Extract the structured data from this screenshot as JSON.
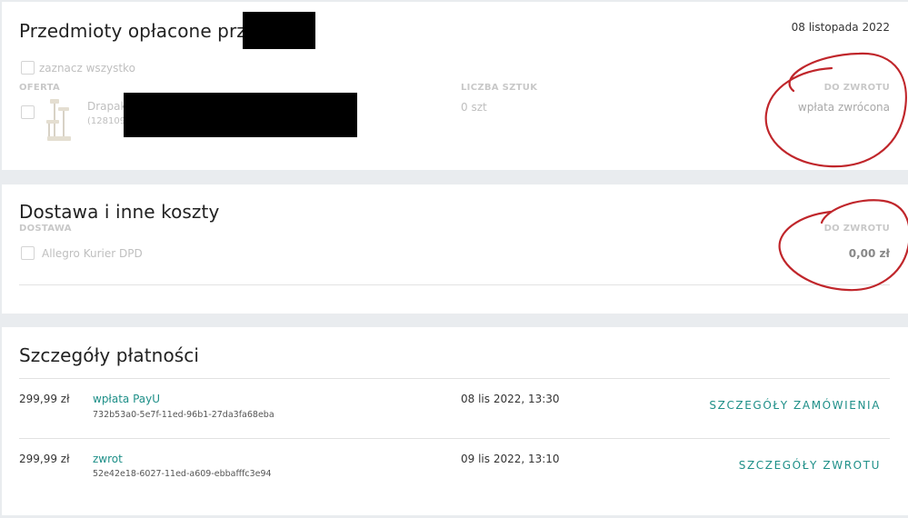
{
  "items_section": {
    "title": "Przedmioty opłacone przez",
    "date": "08 listopada 2022",
    "select_all_label": "zaznacz wszystko",
    "col_offer": "OFERTA",
    "col_quantity": "LICZBA SZTUK",
    "col_refund": "DO ZWROTU",
    "item": {
      "name": "Drapak",
      "id": "(128109",
      "quantity": "0 szt",
      "refund_status": "wpłata zwrócona"
    }
  },
  "delivery_section": {
    "title": "Dostawa i inne koszty",
    "col_delivery": "DOSTAWA",
    "col_refund": "DO ZWROTU",
    "method": "Allegro Kurier DPD",
    "refund_amount": "0,00 zł"
  },
  "payment_section": {
    "title": "Szczegóły płatności",
    "rows": [
      {
        "amount": "299,99 zł",
        "type": "wpłata PayU",
        "transaction_id": "732b53a0-5e7f-11ed-96b1-27da3fa68eba",
        "datetime": "08 lis 2022, 13:30",
        "action": "SZCZEGÓŁY ZAMÓWIENIA"
      },
      {
        "amount": "299,99 zł",
        "type": "zwrot",
        "transaction_id": "52e42e18-6027-11ed-a609-ebbafffc3e94",
        "datetime": "09 lis 2022, 13:10",
        "action": "SZCZEGÓŁY ZWROTU"
      }
    ]
  },
  "colors": {
    "accent": "#1e8f88",
    "annotation": "#c0262b",
    "background": "#e9ecef"
  }
}
